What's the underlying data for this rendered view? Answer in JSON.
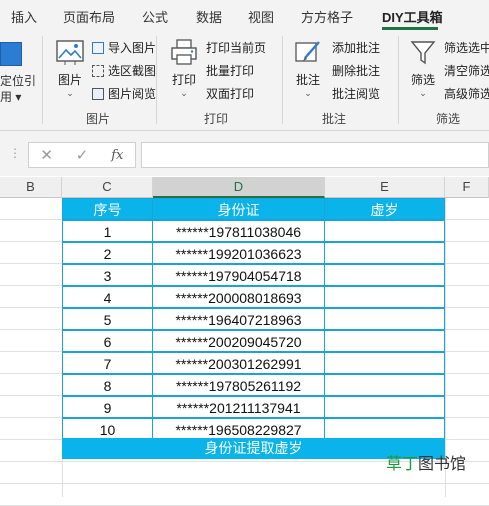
{
  "tabs": {
    "items": [
      "插入",
      "页面布局",
      "公式",
      "数据",
      "视图",
      "方方格子",
      "DIY工具箱"
    ],
    "active": "DIY工具箱"
  },
  "ribbon": {
    "partial_group": {
      "line1": "定位引",
      "line2": "用 ▾"
    },
    "picture_group": {
      "big_label": "图片",
      "items": [
        "导入图片",
        "选区截图",
        "图片阅览"
      ],
      "label": "图片"
    },
    "print_group": {
      "big_label": "打印",
      "items": [
        "打印当前页",
        "批量打印",
        "双面打印"
      ],
      "label": "打印"
    },
    "comment_group": {
      "big_label": "批注",
      "items": [
        "添加批注",
        "删除批注",
        "批注阅览"
      ],
      "label": "批注"
    },
    "filter_group": {
      "big_label": "筛选",
      "items": [
        "筛选选中",
        "清空筛选",
        "高级筛选"
      ],
      "label": "筛选"
    }
  },
  "formula_bar": {
    "fx": "fx",
    "value": ""
  },
  "columns": [
    "B",
    "C",
    "D",
    "E",
    "F"
  ],
  "selected_column": "D",
  "table": {
    "headers": [
      "序号",
      "身份证",
      "虚岁"
    ],
    "rows": [
      {
        "no": "1",
        "id": "******197811038046",
        "age": ""
      },
      {
        "no": "2",
        "id": "******199201036623",
        "age": ""
      },
      {
        "no": "3",
        "id": "******197904054718",
        "age": ""
      },
      {
        "no": "4",
        "id": "******200008018693",
        "age": ""
      },
      {
        "no": "5",
        "id": "******196407218963",
        "age": ""
      },
      {
        "no": "6",
        "id": "******200209045720",
        "age": ""
      },
      {
        "no": "7",
        "id": "******200301262991",
        "age": ""
      },
      {
        "no": "8",
        "id": "******197805261192",
        "age": ""
      },
      {
        "no": "9",
        "id": "******201211137941",
        "age": ""
      },
      {
        "no": "10",
        "id": "******196508229827",
        "age": ""
      }
    ],
    "footer": "身份证提取虚岁"
  },
  "watermark": {
    "green": "草丁",
    "rest": "图书馆"
  },
  "colors": {
    "header_bg": "#0ab3ea",
    "accent": "#217346"
  }
}
